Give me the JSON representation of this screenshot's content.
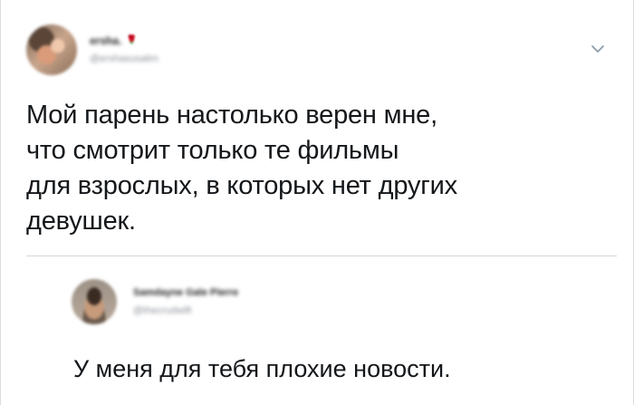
{
  "tweet": {
    "author": {
      "display_name": "ersha.",
      "emoji": "🌹",
      "handle": "@ershasusalim"
    },
    "lines": [
      "Мой парень настолько верен мне,",
      "что смотрит только те фильмы",
      "для взрослых, в которых нет других",
      "девушек."
    ],
    "menu_icon": "chevron-down-icon"
  },
  "reply": {
    "author": {
      "display_name": "Samdayne Gale Pierre",
      "handle": "@thecrudwift"
    },
    "text": "У меня для тебя плохие новости."
  },
  "colors": {
    "text": "#14171a",
    "secondary": "#8a9199",
    "divider": "#d6d6d6",
    "chevron": "#8899a6",
    "background": "#ffffff"
  }
}
